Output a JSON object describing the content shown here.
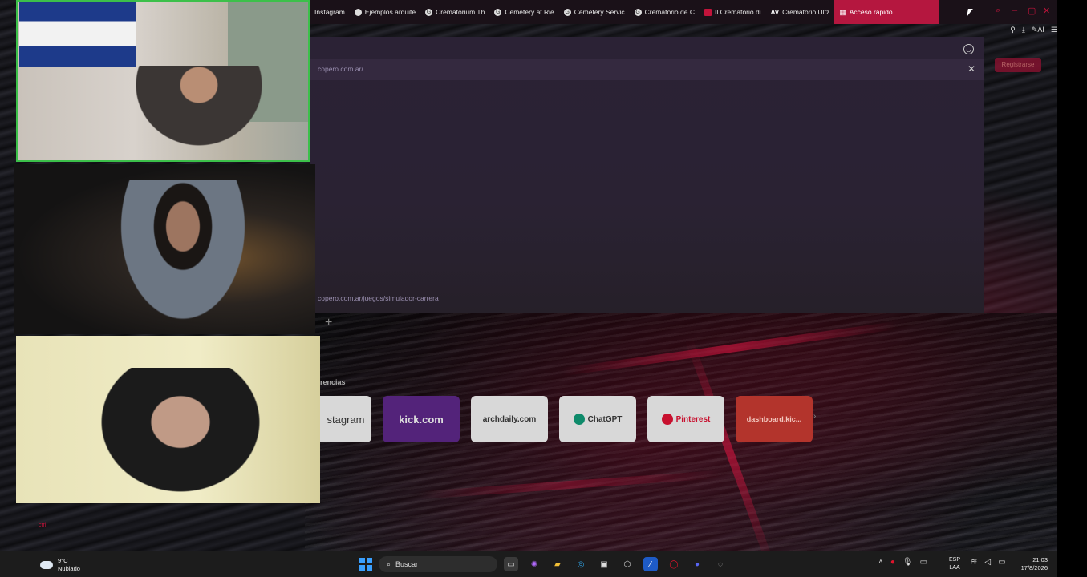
{
  "browser": {
    "tabs": [
      {
        "label": "Instagram",
        "favicon": "instagram-icon"
      },
      {
        "label": "Ejemplos arquite",
        "favicon": "page-icon"
      },
      {
        "label": "Crematorium Th",
        "favicon": "google-icon"
      },
      {
        "label": "Cemetery at Rie",
        "favicon": "google-icon"
      },
      {
        "label": "Cemetery Servic",
        "favicon": "google-icon"
      },
      {
        "label": "Crematorio de C",
        "favicon": "google-icon"
      },
      {
        "label": "Il Crematorio di",
        "favicon": "bars-icon"
      },
      {
        "label": "Crematorio Ultz",
        "favicon": "av-icon"
      }
    ],
    "active_tab": {
      "label": "Acceso rápido",
      "favicon": "grid-icon"
    },
    "toolbar": {
      "ai_label": "AI"
    },
    "dropdown": {
      "url_top": "copero.com.ar/",
      "url_bottom": "copero.com.ar/juegos/simulador-carrera"
    },
    "register_button": "Registrarse",
    "section_title": "rencias",
    "speed_dial": [
      {
        "label": "stagram",
        "kind": "insta"
      },
      {
        "label": "kick.com",
        "kind": "kick"
      },
      {
        "label": "archdaily.com",
        "kind": "plain"
      },
      {
        "label": "ChatGPT",
        "kind": "chatgpt"
      },
      {
        "label": "Pinterest",
        "kind": "pin"
      },
      {
        "label": "dashboard.kic...",
        "kind": "dash"
      }
    ],
    "left_red_text": "ctrl"
  },
  "taskbar": {
    "weather_temp": "9°C",
    "weather_desc": "Nublado",
    "search_placeholder": "Buscar",
    "lang_top": "ESP",
    "lang_bottom": "LAA",
    "time": "21:03",
    "date": "17/8/2026"
  },
  "colors": {
    "accent": "#b5173f",
    "panel": "#2b2235",
    "taskbar": "#1c1c1c"
  }
}
